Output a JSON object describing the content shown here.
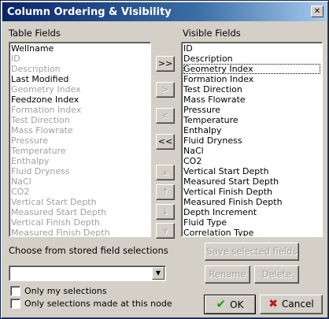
{
  "window": {
    "title": "Column Ordering & Visibility",
    "close_glyph": "✕"
  },
  "table_fields": {
    "label": "Table Fields",
    "items": [
      {
        "text": "Wellname",
        "enabled": true
      },
      {
        "text": "ID",
        "enabled": false
      },
      {
        "text": "Description",
        "enabled": false
      },
      {
        "text": "Last Modified",
        "enabled": true
      },
      {
        "text": "Geometry Index",
        "enabled": false
      },
      {
        "text": "Feedzone Index",
        "enabled": true
      },
      {
        "text": "Formation Index",
        "enabled": false
      },
      {
        "text": "Test Direction",
        "enabled": false
      },
      {
        "text": "Mass Flowrate",
        "enabled": false
      },
      {
        "text": "Pressure",
        "enabled": false
      },
      {
        "text": "Temperature",
        "enabled": false
      },
      {
        "text": "Enthalpy",
        "enabled": false
      },
      {
        "text": "Fluid Dryness",
        "enabled": false
      },
      {
        "text": "NaCl",
        "enabled": false
      },
      {
        "text": "CO2",
        "enabled": false
      },
      {
        "text": "Vertical Start Depth",
        "enabled": false
      },
      {
        "text": "Measured Start Depth",
        "enabled": false
      },
      {
        "text": "Vertical Finish Depth",
        "enabled": false
      },
      {
        "text": "Measured Finish Depth",
        "enabled": false
      }
    ]
  },
  "visible_fields": {
    "label": "Visible Fields",
    "focused_index": 2,
    "items": [
      "ID",
      "Description",
      "Geometry Index",
      "Formation Index",
      "Test Direction",
      "Mass Flowrate",
      "Pressure",
      "Temperature",
      "Enthalpy",
      "Fluid Dryness",
      "NaCl",
      "CO2",
      "Vertical Start Depth",
      "Measured Start Depth",
      "Vertical Finish Depth",
      "Measured Finish Depth",
      "Depth Increment",
      "Fluid Type",
      "Correlation Type"
    ]
  },
  "transfer": {
    "add_all": ">>",
    "add": ">",
    "remove": "<",
    "remove_all": "<<"
  },
  "order": {
    "top_icon": "⩓",
    "up_icon": "↑",
    "down_icon": "↓",
    "bottom_icon": "⩔"
  },
  "stored": {
    "label": "Choose from stored field selections",
    "combo_value": "",
    "save_label": "Save selected fields",
    "rename_label": "Rename",
    "delete_label": "Delete",
    "only_mine_label": "Only my selections",
    "only_node_label": "Only selections made at this node",
    "only_mine_checked": false,
    "only_node_checked": false
  },
  "actions": {
    "ok_label": "OK",
    "cancel_label": "Cancel",
    "ok_color": "#1a9a1a",
    "cancel_color": "#c01818"
  }
}
